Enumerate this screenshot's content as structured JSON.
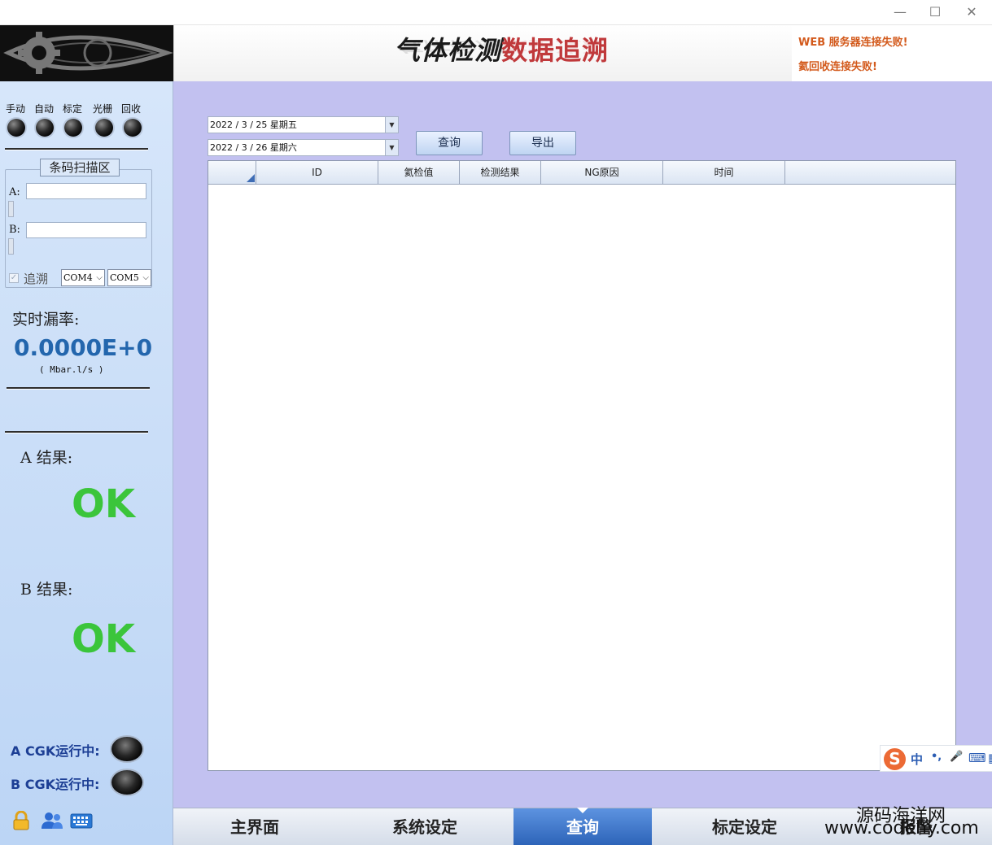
{
  "window": {
    "minimize": "—",
    "maximize": "☐",
    "close": "✕"
  },
  "header": {
    "title_part1": "气体检测",
    "title_part2": "数据追溯",
    "status_lines": [
      "WEB 服务器连接失败!",
      "氦回收连接失败!"
    ],
    "status_color": "#d35a1c"
  },
  "left": {
    "modes": [
      "手动",
      "自动",
      "标定",
      "光栅",
      "回收"
    ],
    "scan_group_title": "条码扫描区",
    "field_a_label": "A:",
    "field_a_value": "",
    "field_b_label": "B:",
    "field_b_value": "",
    "trace_checkbox_label": "追溯",
    "trace_checked": true,
    "com_a": "COM4",
    "com_b": "COM5",
    "leak_label": "实时漏率:",
    "leak_value": "0.0000E+0",
    "leak_unit": "( Mbar.l/s )",
    "result_a_label": "A 结果:",
    "result_a_value": "OK",
    "result_b_label": "B 结果:",
    "result_b_value": "OK",
    "cgk_a_label": "A CGK运行中:",
    "cgk_b_label": "B CGK运行中:",
    "icons": [
      "lock-icon",
      "users-icon",
      "keyboard-icon"
    ]
  },
  "query": {
    "start_date": "2022 / 3 / 25   星期五",
    "end_date": "2022 / 3 / 26   星期六",
    "query_button": "查询",
    "export_button": "导出",
    "columns": [
      "ID",
      "氦检值",
      "检测结果",
      "NG原因",
      "时间"
    ],
    "rows": []
  },
  "ime": {
    "logo": "S",
    "items": [
      "中",
      "•,",
      "🎤",
      "⌨",
      "▦"
    ]
  },
  "nav": {
    "items": [
      "主界面",
      "系统设定",
      "查询",
      "标定设定",
      "报警"
    ],
    "active_index": 2
  },
  "watermark": {
    "line1": "源码海洋网",
    "line2": "www.codehy.com"
  },
  "colors": {
    "main_bg": "#c2c1f0",
    "ok_color": "#3bc53b",
    "leak_color": "#2366ad",
    "nav_active": "#2c63b8"
  }
}
